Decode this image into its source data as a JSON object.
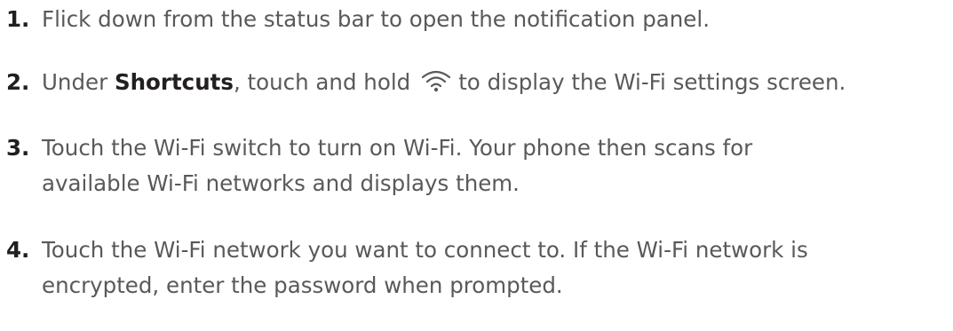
{
  "steps": [
    {
      "number": "1.",
      "text": "Flick down from the status bar to open the notification panel."
    },
    {
      "number": "2.",
      "prefix": "Under ",
      "keyword": "Shortcuts",
      "mid": ", touch and hold",
      "icon": "wifi-icon",
      "suffix": "to display the Wi-Fi settings screen."
    },
    {
      "number": "3.",
      "line1": "Touch the Wi-Fi switch to turn on Wi-Fi. Your phone then scans for",
      "line2": "available Wi-Fi networks and displays them."
    },
    {
      "number": "4.",
      "line1": "Touch the Wi-Fi network you want to connect to. If the Wi-Fi network is",
      "line2": "encrypted, enter the password when prompted."
    }
  ]
}
